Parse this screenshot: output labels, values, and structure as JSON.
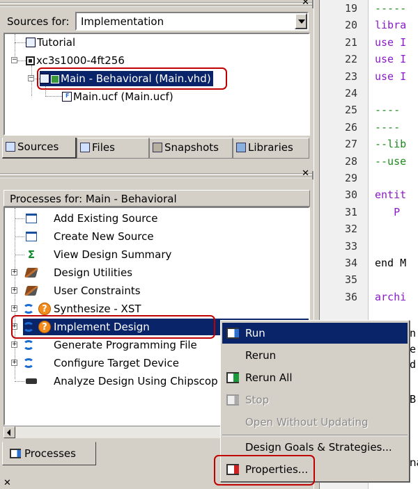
{
  "sources": {
    "label": "Sources for:",
    "selected": "Implementation",
    "tree": [
      {
        "label": "Tutorial",
        "icon": "document-icon"
      },
      {
        "label": "xc3s1000-4ft256",
        "icon": "chip-icon"
      },
      {
        "label": "Main - Behavioral (Main.vhd)",
        "icon": "vhdl-module-icon",
        "selected": true
      },
      {
        "label": "Main.ucf (Main.ucf)",
        "icon": "ucf-file-icon"
      }
    ],
    "tabs": [
      "Sources",
      "Files",
      "Snapshots",
      "Libraries"
    ]
  },
  "processes": {
    "header": "Processes for: Main - Behavioral",
    "items": [
      {
        "label": "Add Existing Source",
        "icon": "form-icon"
      },
      {
        "label": "Create New Source",
        "icon": "form-icon"
      },
      {
        "label": "View Design Summary",
        "icon": "sigma-icon"
      },
      {
        "label": "Design Utilities",
        "icon": "tools-icon"
      },
      {
        "label": "User Constraints",
        "icon": "tools-icon"
      },
      {
        "label": "Synthesize - XST",
        "icon": "process-icon"
      },
      {
        "label": "Implement Design",
        "icon": "process-icon",
        "selected": true
      },
      {
        "label": "Generate Programming File",
        "icon": "process-icon"
      },
      {
        "label": "Configure Target Device",
        "icon": "process-icon"
      },
      {
        "label": "Analyze Design Using Chipscop",
        "icon": "chipscope-icon"
      }
    ],
    "tab": "Processes"
  },
  "editor": {
    "line_numbers": [
      "19",
      "20",
      "21",
      "22",
      "23",
      "24",
      "25",
      "26",
      "27",
      "28",
      "29",
      "30",
      "31",
      "32",
      "33",
      "34",
      "35",
      "36"
    ],
    "lines": [
      {
        "text": "-----",
        "color": "#1a8a1a"
      },
      {
        "text": "libra",
        "color": "#8a1ac8"
      },
      {
        "text": "use I",
        "color": "#8a1ac8"
      },
      {
        "text": "use I",
        "color": "#8a1ac8"
      },
      {
        "text": "use I",
        "color": "#8a1ac8"
      },
      {
        "text": "",
        "color": "#000000"
      },
      {
        "text": "----",
        "color": "#1a8a1a"
      },
      {
        "text": "----",
        "color": "#1a8a1a"
      },
      {
        "text": "--lib",
        "color": "#1a8a1a"
      },
      {
        "text": "--use",
        "color": "#1a8a1a"
      },
      {
        "text": "",
        "color": "#000000"
      },
      {
        "text": "entit",
        "color": "#8a1ac8"
      },
      {
        "text": "   P",
        "color": "#8a1ac8"
      },
      {
        "text": "",
        "color": "#000000"
      },
      {
        "text": "",
        "color": "#000000"
      },
      {
        "text": "end M",
        "color": "#000000"
      },
      {
        "text": "",
        "color": "#000000"
      },
      {
        "text": "archi",
        "color": "#8a1ac8"
      }
    ],
    "right_fragments": [
      "n",
      "e",
      "d",
      "B",
      "na"
    ]
  },
  "context_menu": {
    "items": [
      {
        "label": "Run",
        "icon": "run-icon",
        "state": "hover"
      },
      {
        "label": "Rerun",
        "state": "normal"
      },
      {
        "label": "Rerun All",
        "icon": "run-all-icon",
        "state": "normal"
      },
      {
        "label": "Stop",
        "icon": "stop-icon",
        "state": "disabled"
      },
      {
        "label": "Open Without Updating",
        "state": "disabled"
      },
      {
        "label": "Design Goals & Strategies...",
        "state": "normal"
      },
      {
        "label": "Properties...",
        "icon": "properties-icon",
        "state": "normal"
      }
    ]
  },
  "colors": {
    "selection": "#0a246a",
    "highlight_box": "#c00000",
    "window_bg": "#d4d0c8"
  }
}
